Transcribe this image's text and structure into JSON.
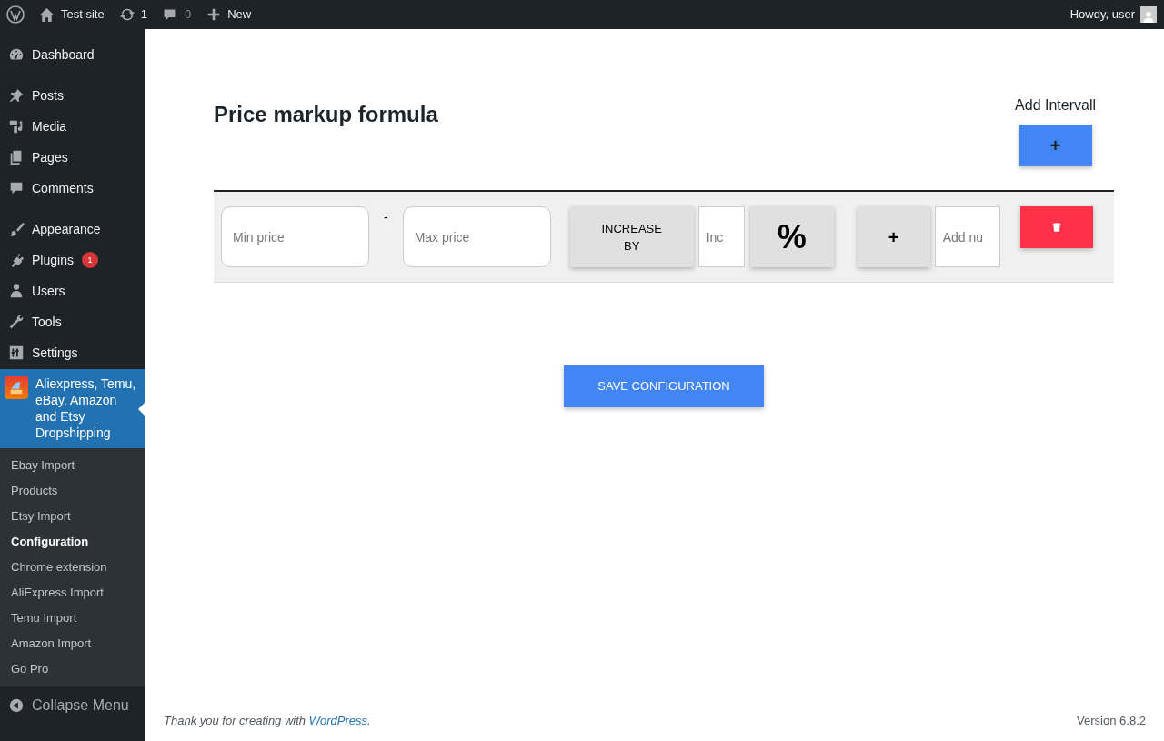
{
  "admin_bar": {
    "site": "Test site",
    "updates": "1",
    "comments": "0",
    "new": "New",
    "greeting": "Howdy, user"
  },
  "menu_groups": [
    [
      {
        "label": "Dashboard",
        "selected": false
      }
    ],
    [
      {
        "label": "Posts",
        "selected": false
      },
      {
        "label": "Media",
        "selected": false
      },
      {
        "label": "Pages",
        "selected": false
      },
      {
        "label": "Comments",
        "selected": false
      }
    ],
    [
      {
        "label": "Appearance",
        "selected": false
      },
      {
        "label": "Plugins",
        "badge": "1",
        "selected": false
      },
      {
        "label": "Users",
        "selected": false
      },
      {
        "label": "Tools",
        "selected": false
      },
      {
        "label": "Settings",
        "selected": false
      },
      {
        "label": "Aliexpress, Temu, eBay, Amazon and Etsy Dropshipping",
        "selected": true
      }
    ]
  ],
  "submenu": [
    {
      "label": "Ebay Import",
      "selected": false
    },
    {
      "label": "Products",
      "selected": false
    },
    {
      "label": "Etsy Import",
      "selected": false
    },
    {
      "label": "Configuration",
      "selected": true
    },
    {
      "label": "Chrome extension",
      "selected": false
    },
    {
      "label": "AliExpress Import",
      "selected": false
    },
    {
      "label": "Temu Import",
      "selected": false
    },
    {
      "label": "Amazon Import",
      "selected": false
    },
    {
      "label": "Go Pro",
      "selected": false
    }
  ],
  "collapse": "Collapse Menu",
  "page": {
    "title": "Price markup formula",
    "add_label": "Add Intervall",
    "add_button": "+",
    "intervals": [
      {
        "min_placeholder": "Min price",
        "separator": "-",
        "max_placeholder": "Max price",
        "mode_button": "INCREASE BY",
        "amount_placeholder": "Inc",
        "unit_button": "%",
        "plus_button": "+",
        "extra_placeholder": "Add nu"
      }
    ],
    "save_button": "SAVE CONFIGURATION"
  },
  "footer": {
    "thanks": "Thank you for creating with",
    "link": "WordPress",
    "period": ".",
    "version": "Version 6.8.2"
  }
}
